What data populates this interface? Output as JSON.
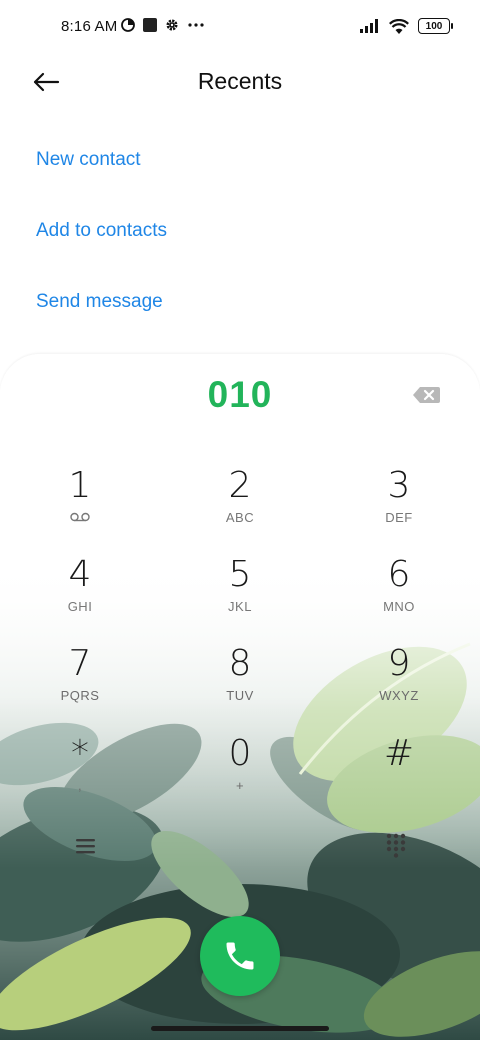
{
  "status_bar": {
    "time": "8:16 AM",
    "left_icons": [
      "data-saver-icon",
      "square-notification-icon",
      "settings-gear-icon",
      "more-dots-icon"
    ],
    "right_icons": [
      "signal-icon",
      "wifi-icon",
      "battery-icon"
    ],
    "battery": "100"
  },
  "header": {
    "back_icon": "arrow-left-icon",
    "title": "Recents"
  },
  "actions": [
    {
      "label": "New contact"
    },
    {
      "label": "Add to contacts"
    },
    {
      "label": "Send message"
    }
  ],
  "dialer": {
    "number": "010",
    "backspace_icon": "backspace-icon",
    "keys": [
      {
        "digit": "1",
        "letters": "",
        "sub_icon": "voicemail-icon"
      },
      {
        "digit": "2",
        "letters": "ABC"
      },
      {
        "digit": "3",
        "letters": "DEF"
      },
      {
        "digit": "4",
        "letters": "GHI"
      },
      {
        "digit": "5",
        "letters": "JKL"
      },
      {
        "digit": "6",
        "letters": "MNO"
      },
      {
        "digit": "7",
        "letters": "PQRS"
      },
      {
        "digit": "8",
        "letters": "TUV"
      },
      {
        "digit": "9",
        "letters": "WXYZ"
      },
      {
        "digit": "*",
        "letters": ","
      },
      {
        "digit": "0",
        "letters": "+"
      },
      {
        "digit": "#",
        "letters": ""
      }
    ],
    "menu_icon": "hamburger-menu-icon",
    "keypad_icon": "dialpad-grid-icon",
    "call_icon": "phone-call-icon"
  },
  "colors": {
    "accent_blue": "#1f86e6",
    "number_green": "#22b45a",
    "call_green": "#1fbb5c"
  }
}
